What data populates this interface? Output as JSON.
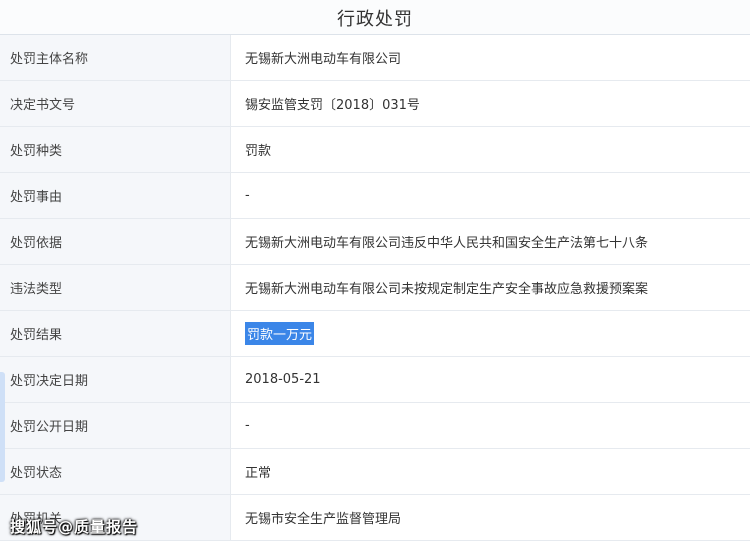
{
  "header": {
    "title": "行政处罚"
  },
  "rows": [
    {
      "label": "处罚主体名称",
      "value": "无锡新大洲电动车有限公司"
    },
    {
      "label": "决定书文号",
      "value": "锡安监管支罚〔2018〕031号"
    },
    {
      "label": "处罚种类",
      "value": "罚款"
    },
    {
      "label": "处罚事由",
      "value": "-"
    },
    {
      "label": "处罚依据",
      "value": "无锡新大洲电动车有限公司违反中华人民共和国安全生产法第七十八条"
    },
    {
      "label": "违法类型",
      "value": "无锡新大洲电动车有限公司未按规定制定生产安全事故应急救援预案案"
    },
    {
      "label": "处罚结果",
      "value": "罚款一万元"
    },
    {
      "label": "处罚决定日期",
      "value": "2018-05-21"
    },
    {
      "label": "处罚公开日期",
      "value": "-"
    },
    {
      "label": "处罚状态",
      "value": "正常"
    },
    {
      "label": "处罚机关",
      "value": "无锡市安全生产监督管理局"
    }
  ],
  "watermark": "搜狐号@质量报告"
}
